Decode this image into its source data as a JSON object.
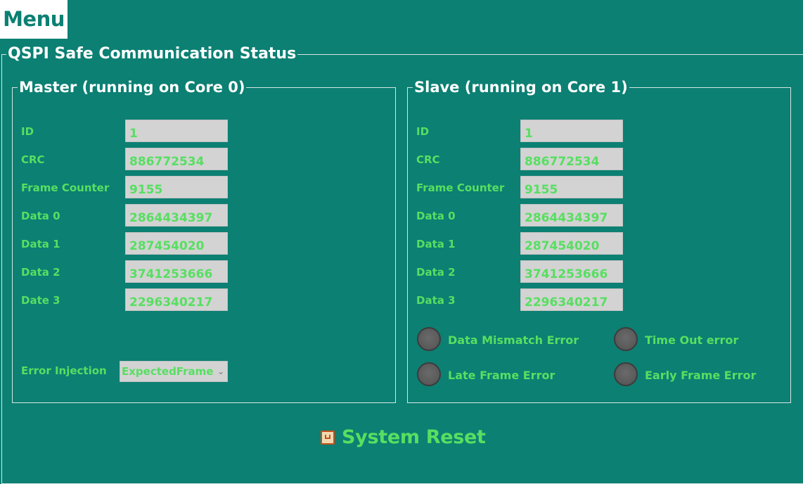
{
  "menu": {
    "label": "Menu"
  },
  "status": {
    "title": "QSPI Safe Communication Status",
    "master": {
      "title": "Master (running on Core 0)",
      "rows": [
        {
          "label": "ID",
          "value": "1"
        },
        {
          "label": "CRC",
          "value": "886772534"
        },
        {
          "label": "Frame Counter",
          "value": "9155"
        },
        {
          "label": "Data 0",
          "value": "2864434397"
        },
        {
          "label": "Data 1",
          "value": "287454020"
        },
        {
          "label": "Data 2",
          "value": "3741253666"
        },
        {
          "label": "Date 3",
          "value": "2296340217"
        }
      ],
      "error_injection": {
        "label": "Error Injection",
        "selected": "ExpectedFrame"
      }
    },
    "slave": {
      "title": "Slave (running on Core 1)",
      "rows": [
        {
          "label": "ID",
          "value": "1"
        },
        {
          "label": "CRC",
          "value": "886772534"
        },
        {
          "label": "Frame Counter",
          "value": "9155"
        },
        {
          "label": "Data 0",
          "value": "2864434397"
        },
        {
          "label": "Data 1",
          "value": "287454020"
        },
        {
          "label": "Data 2",
          "value": "3741253666"
        },
        {
          "label": "Data 3",
          "value": "2296340217"
        }
      ],
      "indicators": [
        {
          "label": "Data Mismatch Error"
        },
        {
          "label": "Time Out error"
        },
        {
          "label": "Late Frame Error"
        },
        {
          "label": "Early Frame Error"
        }
      ]
    }
  },
  "reset": {
    "label": "System Reset"
  },
  "colors": {
    "background": "#0b8073",
    "text_green": "#57df61",
    "field_gray": "#d3d3d3",
    "led_off": "#5a5a5a"
  }
}
